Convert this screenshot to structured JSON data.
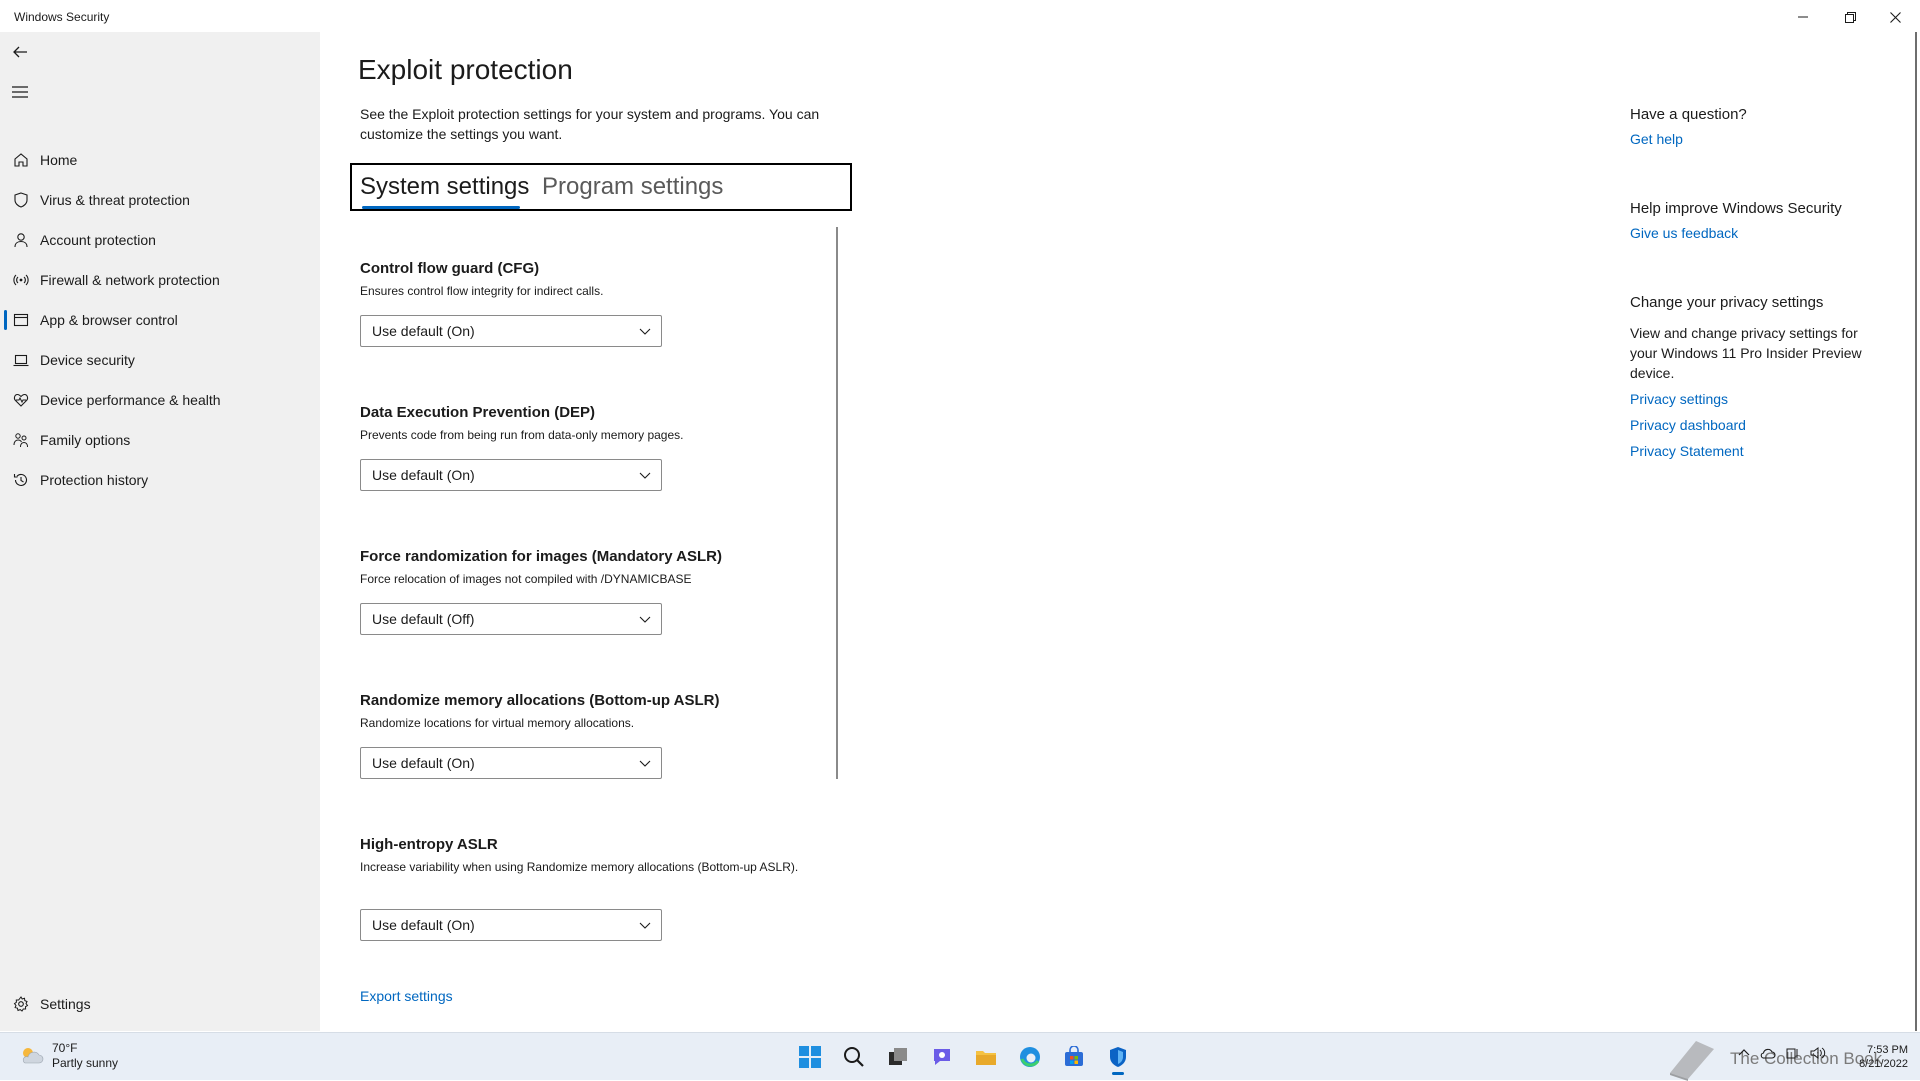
{
  "window": {
    "title": "Windows Security",
    "minimize_icon": "minimize-icon",
    "restore_icon": "restore-icon",
    "close_icon": "close-icon"
  },
  "sidebar": {
    "back_icon": "back-arrow-icon",
    "menu_icon": "hamburger-menu-icon",
    "items": [
      {
        "label": "Home",
        "icon": "home-icon"
      },
      {
        "label": "Virus & threat protection",
        "icon": "shield-icon"
      },
      {
        "label": "Account protection",
        "icon": "person-icon"
      },
      {
        "label": "Firewall & network protection",
        "icon": "wifi-antenna-icon"
      },
      {
        "label": "App & browser control",
        "icon": "app-window-icon",
        "active": true
      },
      {
        "label": "Device security",
        "icon": "laptop-icon"
      },
      {
        "label": "Device performance & health",
        "icon": "heart-pulse-icon"
      },
      {
        "label": "Family options",
        "icon": "family-icon"
      },
      {
        "label": "Protection history",
        "icon": "history-icon"
      }
    ],
    "settings": {
      "label": "Settings",
      "icon": "gear-icon"
    }
  },
  "main": {
    "title": "Exploit protection",
    "description": "See the Exploit protection settings for your system and programs.  You can customize the settings you want.",
    "tabs": [
      {
        "label": "System settings",
        "active": true
      },
      {
        "label": "Program settings",
        "active": false
      }
    ],
    "settings": [
      {
        "title": "Control flow guard (CFG)",
        "description": "Ensures control flow integrity for indirect calls.",
        "value": "Use default (On)"
      },
      {
        "title": "Data Execution Prevention (DEP)",
        "description": "Prevents code from being run from data-only memory pages.",
        "value": "Use default (On)"
      },
      {
        "title": "Force randomization for images (Mandatory ASLR)",
        "description": "Force relocation of images not compiled with /DYNAMICBASE",
        "value": "Use default (Off)"
      },
      {
        "title": "Randomize memory allocations (Bottom-up ASLR)",
        "description": "Randomize locations for virtual memory allocations.",
        "value": "Use default (On)"
      },
      {
        "title": "High-entropy ASLR",
        "description": "Increase variability when using Randomize memory allocations (Bottom-up ASLR).",
        "value": "Use default (On)"
      }
    ],
    "export_link": "Export settings"
  },
  "right_panel": {
    "question": {
      "heading": "Have a question?",
      "link": "Get help"
    },
    "improve": {
      "heading": "Help improve Windows Security",
      "link": "Give us feedback"
    },
    "privacy": {
      "heading": "Change your privacy settings",
      "text": "View and change privacy settings for your Windows 11 Pro Insider Preview device.",
      "links": [
        "Privacy settings",
        "Privacy dashboard",
        "Privacy Statement"
      ]
    }
  },
  "taskbar": {
    "weather": {
      "temp": "70°F",
      "condition": "Partly sunny",
      "icon": "partly-sunny-icon"
    },
    "apps": [
      {
        "name": "start-icon"
      },
      {
        "name": "search-icon"
      },
      {
        "name": "task-view-icon"
      },
      {
        "name": "chat-icon"
      },
      {
        "name": "file-explorer-icon"
      },
      {
        "name": "edge-icon"
      },
      {
        "name": "store-icon"
      },
      {
        "name": "windows-security-icon",
        "active": true
      }
    ],
    "watermark": "The Collection Book",
    "clock": {
      "time": "7:53 PM",
      "date": "8/21/2022"
    }
  },
  "colors": {
    "accent": "#0067c0",
    "sidebar_bg": "#f0f0f0",
    "taskbar_bg": "#e8eef6"
  }
}
